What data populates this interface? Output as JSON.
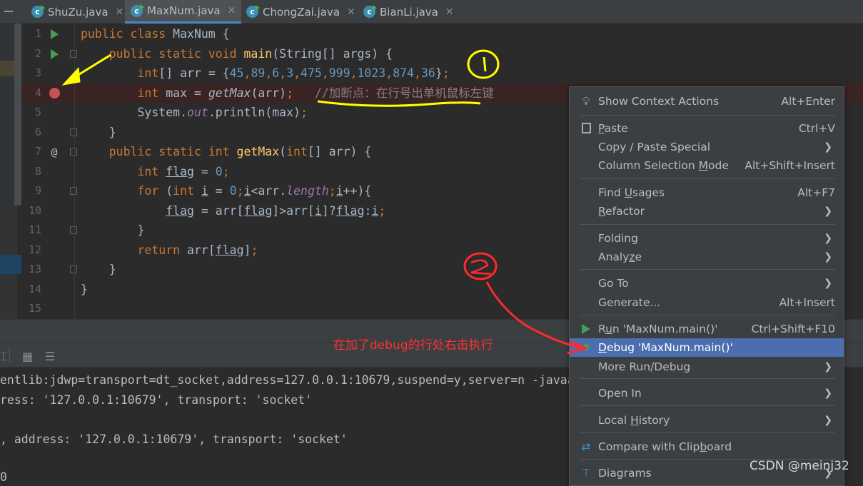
{
  "tabs": [
    {
      "label": "ShuZu.java",
      "active": false
    },
    {
      "label": "MaxNum.java",
      "active": true
    },
    {
      "label": "ChongZai.java",
      "active": false
    },
    {
      "label": "BianLi.java",
      "active": false
    }
  ],
  "editor": {
    "lines": [
      {
        "n": "1",
        "gutter": "run",
        "tokens": [
          [
            "public class ",
            "kw"
          ],
          [
            "MaxNum {",
            "tx"
          ]
        ]
      },
      {
        "n": "2",
        "gutter": "run",
        "fold": true,
        "tokens": [
          [
            "    public static void ",
            "kw"
          ],
          [
            "main",
            "fn"
          ],
          [
            "(String[] args) {",
            "tx"
          ]
        ]
      },
      {
        "n": "3",
        "tokens": [
          [
            "        int",
            "kw"
          ],
          [
            "[] arr = {",
            "tx"
          ],
          [
            "45",
            "num"
          ],
          [
            ",",
            "kw"
          ],
          [
            "89",
            "num"
          ],
          [
            ",",
            "kw"
          ],
          [
            "6",
            "num"
          ],
          [
            ",",
            "kw"
          ],
          [
            "3",
            "num"
          ],
          [
            ",",
            "kw"
          ],
          [
            "475",
            "num"
          ],
          [
            ",",
            "kw"
          ],
          [
            "999",
            "num"
          ],
          [
            ",",
            "kw"
          ],
          [
            "1023",
            "num"
          ],
          [
            ",",
            "kw"
          ],
          [
            "874",
            "num"
          ],
          [
            ",",
            "kw"
          ],
          [
            "36",
            "num"
          ],
          [
            "}",
            "tx"
          ],
          [
            ";",
            "kw"
          ]
        ]
      },
      {
        "n": "4",
        "gutter": "breakpoint",
        "breakpoint": true,
        "tokens": [
          [
            "        int ",
            "kw"
          ],
          [
            "max = ",
            "tx"
          ],
          [
            "getMax",
            "it"
          ],
          [
            "(arr)",
            "tx"
          ],
          [
            ";",
            "kw"
          ],
          [
            "   //加断点：在行号出单机鼠标左键",
            "cm"
          ]
        ]
      },
      {
        "n": "5",
        "tokens": [
          [
            "        System.",
            "tx"
          ],
          [
            "out",
            "fld"
          ],
          [
            ".println(max)",
            "tx"
          ],
          [
            ";",
            "kw"
          ]
        ]
      },
      {
        "n": "6",
        "fold": true,
        "tokens": [
          [
            "    }",
            "tx"
          ]
        ]
      },
      {
        "n": "7",
        "gutter": "at",
        "fold": true,
        "tokens": [
          [
            "    public static int ",
            "kw"
          ],
          [
            "getMax",
            "fn"
          ],
          [
            "(",
            "tx"
          ],
          [
            "int",
            "kw"
          ],
          [
            "[] arr) {",
            "tx"
          ]
        ]
      },
      {
        "n": "8",
        "tokens": [
          [
            "        int ",
            "kw"
          ],
          [
            "flag",
            "ul"
          ],
          [
            " = ",
            "tx"
          ],
          [
            "0",
            "num"
          ],
          [
            ";",
            "kw"
          ]
        ]
      },
      {
        "n": "9",
        "fold": true,
        "tokens": [
          [
            "        for ",
            "kw"
          ],
          [
            "(",
            "tx"
          ],
          [
            "int ",
            "kw"
          ],
          [
            "i",
            "ul"
          ],
          [
            " = ",
            "tx"
          ],
          [
            "0",
            "num"
          ],
          [
            ";",
            "kw"
          ],
          [
            "i",
            "ul"
          ],
          [
            "<arr.",
            "tx"
          ],
          [
            "length",
            "fld"
          ],
          [
            ";",
            "kw"
          ],
          [
            "i",
            "ul"
          ],
          [
            "++){",
            "tx"
          ]
        ]
      },
      {
        "n": "10",
        "tokens": [
          [
            "            ",
            "tx"
          ],
          [
            "flag",
            "ul"
          ],
          [
            " = arr[",
            "tx"
          ],
          [
            "flag",
            "ul"
          ],
          [
            "]>arr[",
            "tx"
          ],
          [
            "i",
            "ul"
          ],
          [
            "]?",
            "tx"
          ],
          [
            "flag",
            "ul"
          ],
          [
            ":",
            "tx"
          ],
          [
            "i",
            "ul"
          ],
          [
            ";",
            "kw"
          ]
        ]
      },
      {
        "n": "11",
        "fold": true,
        "tokens": [
          [
            "        }",
            "tx"
          ]
        ]
      },
      {
        "n": "12",
        "tokens": [
          [
            "        return ",
            "kw"
          ],
          [
            "arr[",
            "tx"
          ],
          [
            "flag",
            "ul"
          ],
          [
            "]",
            "tx"
          ],
          [
            ";",
            "kw"
          ]
        ]
      },
      {
        "n": "13",
        "fold": true,
        "tokens": [
          [
            "    }",
            "tx"
          ]
        ]
      },
      {
        "n": "14",
        "tokens": [
          [
            "}",
            "tx"
          ]
        ]
      },
      {
        "n": "15",
        "tokens": []
      }
    ]
  },
  "console": {
    "lines": [
      "entlib:jdwp=transport=dt_socket,address=127.0.0.1:10679,suspend=y,server=n -javaagent:D:\\Bra",
      "ress: '127.0.0.1:10679', transport: 'socket'",
      ", address: '127.0.0.1:10679', transport: 'socket'",
      "0"
    ]
  },
  "context_menu": {
    "items": [
      {
        "icon": "lightbulb-icon",
        "pre": "",
        "u": "",
        "post": "Show Context Actions",
        "shortcut": "Alt+Enter"
      },
      {
        "icon": "clipboard-icon",
        "pre": "",
        "u": "P",
        "post": "aste",
        "shortcut": "Ctrl+V"
      },
      {
        "pre": "Copy / Paste Special",
        "u": "",
        "post": "",
        "submenu": true
      },
      {
        "pre": "Column Selection ",
        "u": "M",
        "post": "ode",
        "shortcut": "Alt+Shift+Insert"
      },
      {
        "pre": "Find ",
        "u": "U",
        "post": "sages",
        "shortcut": "Alt+F7"
      },
      {
        "pre": "",
        "u": "R",
        "post": "efactor",
        "submenu": true
      },
      {
        "pre": "Folding",
        "u": "",
        "post": "",
        "submenu": true
      },
      {
        "pre": "Analy",
        "u": "z",
        "post": "e",
        "submenu": true
      },
      {
        "pre": "Go To",
        "u": "",
        "post": "",
        "submenu": true
      },
      {
        "pre": "Generate...",
        "u": "",
        "post": "",
        "shortcut": "Alt+Insert"
      },
      {
        "icon": "run-icon",
        "pre": "R",
        "u": "u",
        "post": "n 'MaxNum.main()'",
        "shortcut": "Ctrl+Shift+F10"
      },
      {
        "icon": "debug-icon",
        "pre": "",
        "u": "D",
        "post": "ebug 'MaxNum.main()'",
        "selected": true
      },
      {
        "pre": "More Run/Debug",
        "u": "",
        "post": "",
        "submenu": true
      },
      {
        "pre": "Open In",
        "u": "",
        "post": "",
        "submenu": true
      },
      {
        "pre": "Local ",
        "u": "H",
        "post": "istory",
        "submenu": true
      },
      {
        "icon": "compare-icon",
        "pre": "Compare with Clip",
        "u": "b",
        "post": "oard"
      },
      {
        "icon": "diagram-icon",
        "pre": "Diagrams",
        "u": "",
        "post": "",
        "submenu": true
      }
    ]
  },
  "annotations": {
    "circle1": "1",
    "circle2": "2",
    "red_note": "在加了debug的行处右击执行",
    "yellow_color": "#ffff00",
    "red_color": "#ff2a2a"
  },
  "watermark": "CSDN @meinj32",
  "colors": {
    "keyword": "#cc7832",
    "number": "#6897bb",
    "method": "#ffc66d",
    "text": "#a9b7c6",
    "comment": "#808080",
    "selection": "#4b6eaf",
    "breakpoint": "#c75450"
  }
}
